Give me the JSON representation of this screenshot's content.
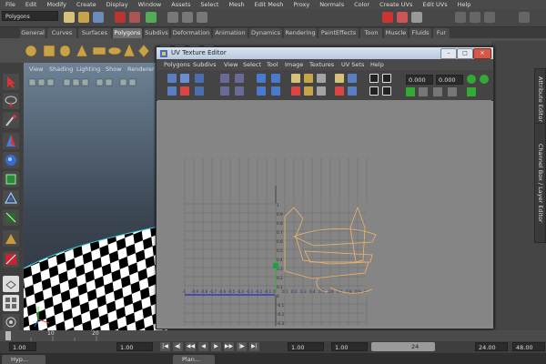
{
  "menubar": [
    "File",
    "Edit",
    "Modify",
    "Create",
    "Display",
    "Window",
    "Assets",
    "Select",
    "Mesh",
    "Edit Mesh",
    "Proxy",
    "Normals",
    "Color",
    "Create UVs",
    "Edit UVs",
    "Help"
  ],
  "menuset": "Polygons",
  "shelf_tabs": [
    "General",
    "Curves",
    "Surfaces",
    "Polygons",
    "Subdivs",
    "Deformation",
    "Animation",
    "Dynamics",
    "Rendering",
    "PaintEffects",
    "Toon",
    "Muscle",
    "Fluids",
    "Fur"
  ],
  "active_shelf": "Polygons",
  "viewport_menu": [
    "View",
    "Shading",
    "Lighting",
    "Show",
    "Renderer"
  ],
  "uv_window": {
    "title": "UV Texture Editor",
    "menu": [
      "Polygons",
      "Subdivs",
      "View",
      "Select",
      "Tool",
      "Image",
      "Textures",
      "UV Sets",
      "Help"
    ],
    "field_u": "0.000",
    "field_v": "0.000",
    "winbtn_min": "–",
    "winbtn_max": "□",
    "winbtn_close": "×",
    "grid_u_labels": [
      "-1",
      "-0.9",
      "-0.8",
      "-0.7",
      "-0.6",
      "-0.5",
      "-0.4",
      "-0.3",
      "-0.2",
      "-0.1",
      "0",
      "0.1",
      "0.2",
      "0.3",
      "0.4",
      "0.5",
      "0.6",
      "0.7",
      "0.8",
      "0.9",
      "1"
    ],
    "grid_v_labels": [
      "1",
      "0.9",
      "0.8",
      "0.7",
      "0.6",
      "0.5",
      "0.4",
      "0.3",
      "0.2",
      "0.1",
      "0",
      "-0.1",
      "-0.2",
      "-0.3",
      "-0.4",
      "-0.5",
      "-0.6",
      "-0.7",
      "-0.8",
      "-0.9"
    ]
  },
  "side_tabs": [
    "Attribute Editor",
    "Channel Box / Layer Editor"
  ],
  "timeline": {
    "ticks": [
      "10",
      "20"
    ]
  },
  "range": {
    "start": "1.00",
    "start2": "1.00",
    "current": "1.00",
    "range_end": "24",
    "end": "24.00",
    "end2": "48.00",
    "left_value": "1.00"
  },
  "playback_glyphs": [
    "|◀",
    "◀|",
    "◀◀",
    "◀",
    "▶",
    "▶▶",
    "|▶",
    "▶|"
  ],
  "taskbar": [
    "Hyp...",
    "Plan..."
  ],
  "colors": {
    "accent": "#6e6e6e",
    "uv_line": "#f0b36a",
    "grid_axis_blue": "#2030c0",
    "grid_axis_green": "#20a040"
  }
}
